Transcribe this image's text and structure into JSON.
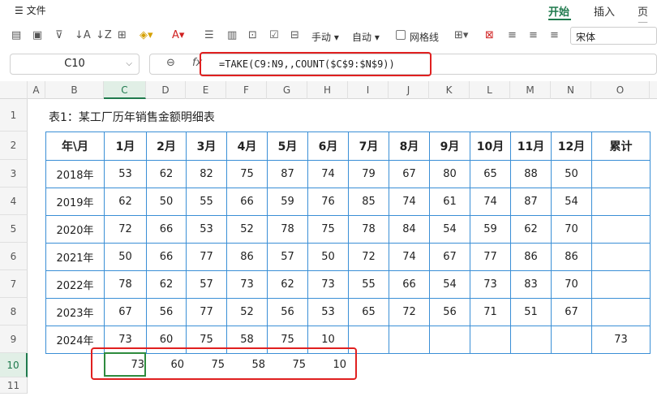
{
  "menu": {
    "file_label": "文件",
    "tabs": [
      "开始",
      "插入",
      "页面"
    ]
  },
  "toolbar": {
    "manual_label": "手动",
    "auto_label": "自动",
    "gridlines_label": "网格线",
    "font_value": "宋体"
  },
  "formula_bar": {
    "cell_ref": "C10",
    "fx_label": "fx",
    "formula": "=TAKE(C9:N9,,COUNT($C$9:$N$9))"
  },
  "columns": [
    "A",
    "B",
    "C",
    "D",
    "E",
    "F",
    "G",
    "H",
    "I",
    "J",
    "K",
    "L",
    "M",
    "N",
    "O"
  ],
  "rows": [
    "1",
    "2",
    "3",
    "4",
    "5",
    "6",
    "7",
    "8",
    "9",
    "10",
    "11"
  ],
  "sheet": {
    "title": "表1：某工厂历年销售金额明细表",
    "headers": [
      "年\\月",
      "1月",
      "2月",
      "3月",
      "4月",
      "5月",
      "6月",
      "7月",
      "8月",
      "9月",
      "10月",
      "11月",
      "12月",
      "累计"
    ],
    "data": [
      [
        "2018年",
        "53",
        "62",
        "82",
        "75",
        "87",
        "74",
        "79",
        "67",
        "80",
        "65",
        "88",
        "50",
        ""
      ],
      [
        "2019年",
        "62",
        "50",
        "55",
        "66",
        "59",
        "76",
        "85",
        "74",
        "61",
        "74",
        "87",
        "54",
        ""
      ],
      [
        "2020年",
        "72",
        "66",
        "53",
        "52",
        "78",
        "75",
        "78",
        "84",
        "54",
        "59",
        "62",
        "70",
        ""
      ],
      [
        "2021年",
        "50",
        "66",
        "77",
        "86",
        "57",
        "50",
        "72",
        "74",
        "67",
        "77",
        "86",
        "86",
        ""
      ],
      [
        "2022年",
        "78",
        "62",
        "57",
        "73",
        "62",
        "73",
        "55",
        "66",
        "54",
        "73",
        "83",
        "70",
        ""
      ],
      [
        "2023年",
        "67",
        "56",
        "77",
        "52",
        "56",
        "53",
        "65",
        "72",
        "56",
        "71",
        "51",
        "67",
        ""
      ],
      [
        "2024年",
        "73",
        "60",
        "75",
        "58",
        "75",
        "10",
        "",
        "",
        "",
        "",
        "",
        "",
        "73"
      ]
    ],
    "result_row": [
      "73",
      "60",
      "75",
      "58",
      "75",
      "10"
    ]
  },
  "colors": {
    "accent": "#1f7a4d",
    "table_border": "#3a8fd6",
    "highlight": "#e02020"
  }
}
